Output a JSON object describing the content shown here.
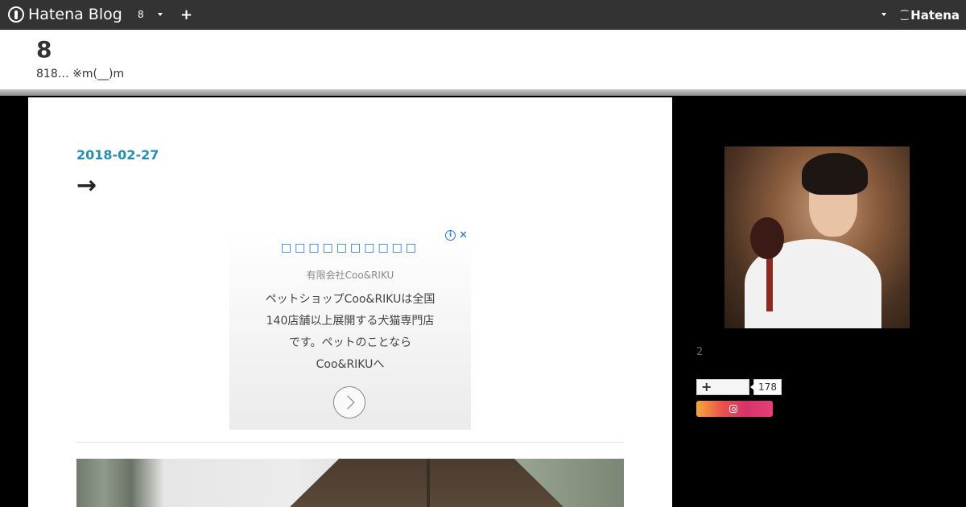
{
  "topbar": {
    "logo_text": "Hatena Blog",
    "blog_switch": "8",
    "add_label": "+",
    "brand": "Hatena"
  },
  "blog": {
    "title": "8",
    "description": "818… ※m(__)m"
  },
  "entry": {
    "date": "2018-02-27",
    "title": "→"
  },
  "ad": {
    "headline": "□□□□□□□□□□",
    "advertiser": "有限会社Coo&RIKU",
    "body_lines": [
      "ペットショップCoo&RIKUは全国",
      "140店舗以上展開する犬猫専門店",
      "です。ペットのことなら",
      "Coo&RIKUへ"
    ]
  },
  "sidebar": {
    "count": "2",
    "follow_count": "178"
  },
  "colors": {
    "topbar": "#333333",
    "date_link": "#238db3",
    "ad_link": "#1a73e8"
  }
}
